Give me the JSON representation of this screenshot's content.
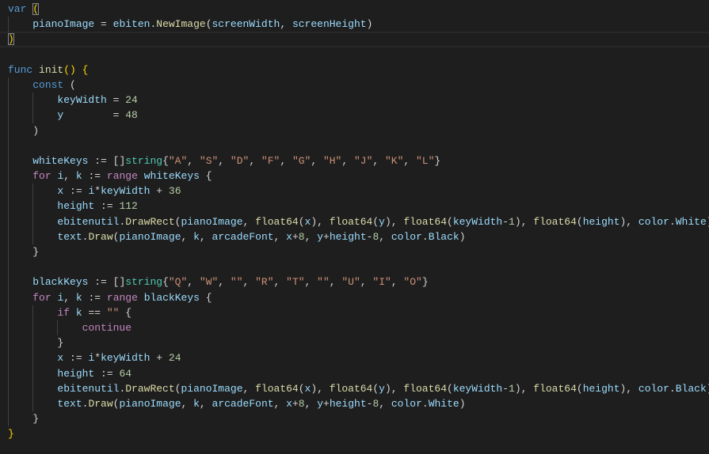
{
  "editor": {
    "current_line": 3,
    "colors": {
      "background": "#1e1e1e",
      "keyword": "#569cd6",
      "control": "#c586c0",
      "variable": "#9cdcfe",
      "function": "#dcdcaa",
      "type": "#4ec9b0",
      "number": "#b5cea8",
      "string": "#ce9178",
      "text": "#d4d4d4"
    },
    "lines": [
      {
        "indent": 0,
        "tokens": [
          [
            "k",
            "var"
          ],
          [
            "p",
            " "
          ],
          [
            "b",
            "(",
            "match"
          ]
        ]
      },
      {
        "indent": 1,
        "tokens": [
          [
            "v",
            "pianoImage"
          ],
          [
            "p",
            " = "
          ],
          [
            "v",
            "ebiten"
          ],
          [
            "p",
            "."
          ],
          [
            "f",
            "NewImage"
          ],
          [
            "p",
            "("
          ],
          [
            "v",
            "screenWidth"
          ],
          [
            "p",
            ", "
          ],
          [
            "v",
            "screenHeight"
          ],
          [
            "p",
            ")"
          ]
        ]
      },
      {
        "indent": 0,
        "tokens": [
          [
            "b",
            ")",
            "match"
          ]
        ]
      },
      {
        "indent": 0,
        "tokens": []
      },
      {
        "indent": 0,
        "tokens": [
          [
            "k",
            "func"
          ],
          [
            "p",
            " "
          ],
          [
            "f",
            "init"
          ],
          [
            "b",
            "()"
          ],
          [
            "p",
            " "
          ],
          [
            "b",
            "{"
          ]
        ]
      },
      {
        "indent": 1,
        "tokens": [
          [
            "k",
            "const"
          ],
          [
            "p",
            " ("
          ]
        ]
      },
      {
        "indent": 2,
        "tokens": [
          [
            "v",
            "keyWidth"
          ],
          [
            "p",
            " = "
          ],
          [
            "n",
            "24"
          ]
        ]
      },
      {
        "indent": 2,
        "tokens": [
          [
            "v",
            "y"
          ],
          [
            "p",
            "        = "
          ],
          [
            "n",
            "48"
          ]
        ]
      },
      {
        "indent": 1,
        "tokens": [
          [
            "p",
            ")"
          ]
        ]
      },
      {
        "indent": 0,
        "tokens": []
      },
      {
        "indent": 1,
        "tokens": [
          [
            "v",
            "whiteKeys"
          ],
          [
            "p",
            " := []"
          ],
          [
            "t",
            "string"
          ],
          [
            "p",
            "{"
          ],
          [
            "s",
            "\"A\""
          ],
          [
            "p",
            ", "
          ],
          [
            "s",
            "\"S\""
          ],
          [
            "p",
            ", "
          ],
          [
            "s",
            "\"D\""
          ],
          [
            "p",
            ", "
          ],
          [
            "s",
            "\"F\""
          ],
          [
            "p",
            ", "
          ],
          [
            "s",
            "\"G\""
          ],
          [
            "p",
            ", "
          ],
          [
            "s",
            "\"H\""
          ],
          [
            "p",
            ", "
          ],
          [
            "s",
            "\"J\""
          ],
          [
            "p",
            ", "
          ],
          [
            "s",
            "\"K\""
          ],
          [
            "p",
            ", "
          ],
          [
            "s",
            "\"L\""
          ],
          [
            "p",
            "}"
          ]
        ]
      },
      {
        "indent": 1,
        "tokens": [
          [
            "c",
            "for"
          ],
          [
            "p",
            " "
          ],
          [
            "v",
            "i"
          ],
          [
            "p",
            ", "
          ],
          [
            "v",
            "k"
          ],
          [
            "p",
            " := "
          ],
          [
            "c",
            "range"
          ],
          [
            "p",
            " "
          ],
          [
            "v",
            "whiteKeys"
          ],
          [
            "p",
            " {"
          ]
        ]
      },
      {
        "indent": 2,
        "tokens": [
          [
            "v",
            "x"
          ],
          [
            "p",
            " := "
          ],
          [
            "v",
            "i"
          ],
          [
            "p",
            "*"
          ],
          [
            "v",
            "keyWidth"
          ],
          [
            "p",
            " + "
          ],
          [
            "n",
            "36"
          ]
        ]
      },
      {
        "indent": 2,
        "tokens": [
          [
            "v",
            "height"
          ],
          [
            "p",
            " := "
          ],
          [
            "n",
            "112"
          ]
        ]
      },
      {
        "indent": 2,
        "tokens": [
          [
            "v",
            "ebitenutil"
          ],
          [
            "p",
            "."
          ],
          [
            "f",
            "DrawRect"
          ],
          [
            "p",
            "("
          ],
          [
            "v",
            "pianoImage"
          ],
          [
            "p",
            ", "
          ],
          [
            "f",
            "float64"
          ],
          [
            "p",
            "("
          ],
          [
            "v",
            "x"
          ],
          [
            "p",
            "), "
          ],
          [
            "f",
            "float64"
          ],
          [
            "p",
            "("
          ],
          [
            "v",
            "y"
          ],
          [
            "p",
            "), "
          ],
          [
            "f",
            "float64"
          ],
          [
            "p",
            "("
          ],
          [
            "v",
            "keyWidth"
          ],
          [
            "p",
            "-"
          ],
          [
            "n",
            "1"
          ],
          [
            "p",
            "), "
          ],
          [
            "f",
            "float64"
          ],
          [
            "p",
            "("
          ],
          [
            "v",
            "height"
          ],
          [
            "p",
            "), "
          ],
          [
            "v",
            "color"
          ],
          [
            "p",
            "."
          ],
          [
            "v",
            "White"
          ],
          [
            "p",
            ")"
          ]
        ]
      },
      {
        "indent": 2,
        "tokens": [
          [
            "v",
            "text"
          ],
          [
            "p",
            "."
          ],
          [
            "f",
            "Draw"
          ],
          [
            "p",
            "("
          ],
          [
            "v",
            "pianoImage"
          ],
          [
            "p",
            ", "
          ],
          [
            "v",
            "k"
          ],
          [
            "p",
            ", "
          ],
          [
            "v",
            "arcadeFont"
          ],
          [
            "p",
            ", "
          ],
          [
            "v",
            "x"
          ],
          [
            "p",
            "+"
          ],
          [
            "n",
            "8"
          ],
          [
            "p",
            ", "
          ],
          [
            "v",
            "y"
          ],
          [
            "p",
            "+"
          ],
          [
            "v",
            "height"
          ],
          [
            "p",
            "-"
          ],
          [
            "n",
            "8"
          ],
          [
            "p",
            ", "
          ],
          [
            "v",
            "color"
          ],
          [
            "p",
            "."
          ],
          [
            "v",
            "Black"
          ],
          [
            "p",
            ")"
          ]
        ]
      },
      {
        "indent": 1,
        "tokens": [
          [
            "p",
            "}"
          ]
        ]
      },
      {
        "indent": 0,
        "tokens": []
      },
      {
        "indent": 1,
        "tokens": [
          [
            "v",
            "blackKeys"
          ],
          [
            "p",
            " := []"
          ],
          [
            "t",
            "string"
          ],
          [
            "p",
            "{"
          ],
          [
            "s",
            "\"Q\""
          ],
          [
            "p",
            ", "
          ],
          [
            "s",
            "\"W\""
          ],
          [
            "p",
            ", "
          ],
          [
            "s",
            "\"\""
          ],
          [
            "p",
            ", "
          ],
          [
            "s",
            "\"R\""
          ],
          [
            "p",
            ", "
          ],
          [
            "s",
            "\"T\""
          ],
          [
            "p",
            ", "
          ],
          [
            "s",
            "\"\""
          ],
          [
            "p",
            ", "
          ],
          [
            "s",
            "\"U\""
          ],
          [
            "p",
            ", "
          ],
          [
            "s",
            "\"I\""
          ],
          [
            "p",
            ", "
          ],
          [
            "s",
            "\"O\""
          ],
          [
            "p",
            "}"
          ]
        ]
      },
      {
        "indent": 1,
        "tokens": [
          [
            "c",
            "for"
          ],
          [
            "p",
            " "
          ],
          [
            "v",
            "i"
          ],
          [
            "p",
            ", "
          ],
          [
            "v",
            "k"
          ],
          [
            "p",
            " := "
          ],
          [
            "c",
            "range"
          ],
          [
            "p",
            " "
          ],
          [
            "v",
            "blackKeys"
          ],
          [
            "p",
            " {"
          ]
        ]
      },
      {
        "indent": 2,
        "tokens": [
          [
            "c",
            "if"
          ],
          [
            "p",
            " "
          ],
          [
            "v",
            "k"
          ],
          [
            "p",
            " == "
          ],
          [
            "s",
            "\"\""
          ],
          [
            "p",
            " {"
          ]
        ]
      },
      {
        "indent": 3,
        "tokens": [
          [
            "c",
            "continue"
          ]
        ]
      },
      {
        "indent": 2,
        "tokens": [
          [
            "p",
            "}"
          ]
        ]
      },
      {
        "indent": 2,
        "tokens": [
          [
            "v",
            "x"
          ],
          [
            "p",
            " := "
          ],
          [
            "v",
            "i"
          ],
          [
            "p",
            "*"
          ],
          [
            "v",
            "keyWidth"
          ],
          [
            "p",
            " + "
          ],
          [
            "n",
            "24"
          ]
        ]
      },
      {
        "indent": 2,
        "tokens": [
          [
            "v",
            "height"
          ],
          [
            "p",
            " := "
          ],
          [
            "n",
            "64"
          ]
        ]
      },
      {
        "indent": 2,
        "tokens": [
          [
            "v",
            "ebitenutil"
          ],
          [
            "p",
            "."
          ],
          [
            "f",
            "DrawRect"
          ],
          [
            "p",
            "("
          ],
          [
            "v",
            "pianoImage"
          ],
          [
            "p",
            ", "
          ],
          [
            "f",
            "float64"
          ],
          [
            "p",
            "("
          ],
          [
            "v",
            "x"
          ],
          [
            "p",
            "), "
          ],
          [
            "f",
            "float64"
          ],
          [
            "p",
            "("
          ],
          [
            "v",
            "y"
          ],
          [
            "p",
            "), "
          ],
          [
            "f",
            "float64"
          ],
          [
            "p",
            "("
          ],
          [
            "v",
            "keyWidth"
          ],
          [
            "p",
            "-"
          ],
          [
            "n",
            "1"
          ],
          [
            "p",
            "), "
          ],
          [
            "f",
            "float64"
          ],
          [
            "p",
            "("
          ],
          [
            "v",
            "height"
          ],
          [
            "p",
            "), "
          ],
          [
            "v",
            "color"
          ],
          [
            "p",
            "."
          ],
          [
            "v",
            "Black"
          ],
          [
            "p",
            ")"
          ]
        ]
      },
      {
        "indent": 2,
        "tokens": [
          [
            "v",
            "text"
          ],
          [
            "p",
            "."
          ],
          [
            "f",
            "Draw"
          ],
          [
            "p",
            "("
          ],
          [
            "v",
            "pianoImage"
          ],
          [
            "p",
            ", "
          ],
          [
            "v",
            "k"
          ],
          [
            "p",
            ", "
          ],
          [
            "v",
            "arcadeFont"
          ],
          [
            "p",
            ", "
          ],
          [
            "v",
            "x"
          ],
          [
            "p",
            "+"
          ],
          [
            "n",
            "8"
          ],
          [
            "p",
            ", "
          ],
          [
            "v",
            "y"
          ],
          [
            "p",
            "+"
          ],
          [
            "v",
            "height"
          ],
          [
            "p",
            "-"
          ],
          [
            "n",
            "8"
          ],
          [
            "p",
            ", "
          ],
          [
            "v",
            "color"
          ],
          [
            "p",
            "."
          ],
          [
            "v",
            "White"
          ],
          [
            "p",
            ")"
          ]
        ]
      },
      {
        "indent": 1,
        "tokens": [
          [
            "p",
            "}"
          ]
        ]
      },
      {
        "indent": 0,
        "tokens": [
          [
            "b",
            "}"
          ]
        ]
      }
    ]
  }
}
